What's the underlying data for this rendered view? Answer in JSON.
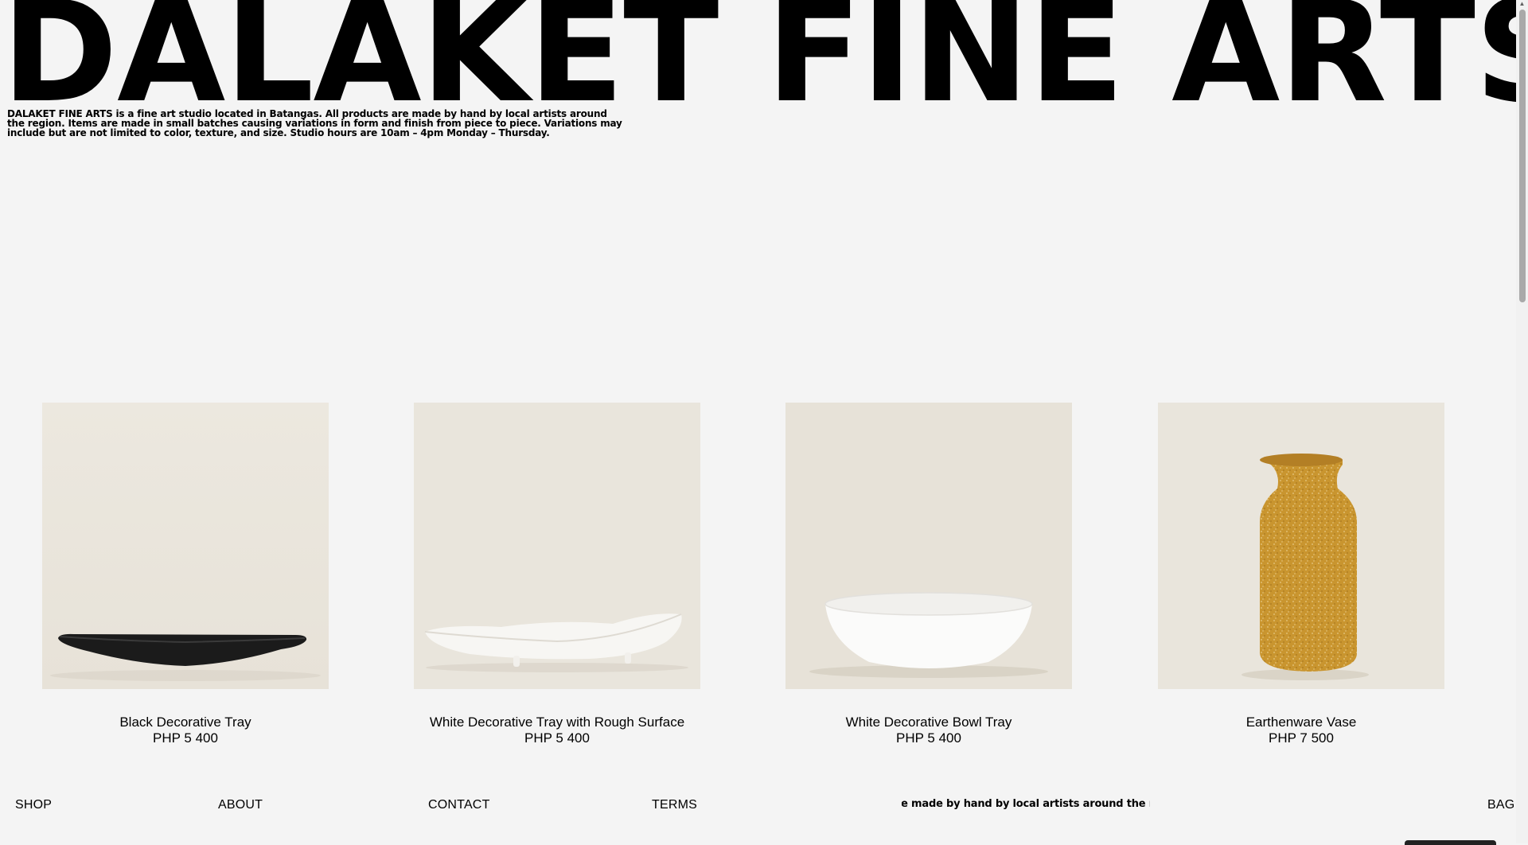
{
  "brand": {
    "title": "DALAKET FINE ARTS",
    "intro": "DALAKET FINE ARTS is a fine art studio located in Batangas. All products are made by hand by local artists around the region. Items are made in small batches causing variations in form and finish from piece to piece. Variations may include but are not limited to color, texture, and size. Studio hours are 10am – 4pm Monday – Thursday."
  },
  "products": [
    {
      "name": "Black Decorative Tray",
      "price": "PHP 5 400"
    },
    {
      "name": "White Decorative Tray with Rough Surface",
      "price": "PHP 5 400"
    },
    {
      "name": "White Decorative Bowl Tray",
      "price": "PHP 5 400"
    },
    {
      "name": "Earthenware Vase",
      "price": "PHP 7 500"
    }
  ],
  "footer": {
    "shop": "SHOP",
    "about": "ABOUT",
    "contact": "CONTACT",
    "terms": "TERMS",
    "marquee": "DALAKET FINE ARTS is a fine art studio located in Batangas. All products are made by hand by local artists around the region. Studio hours are 10am – 4pm Monday – Thursday.",
    "bag": "BAG"
  },
  "colors": {
    "background": "#f4f4f4",
    "text": "#000000",
    "image_backdrop": "#e9e5dc",
    "vase_ochre": "#c9952f"
  }
}
